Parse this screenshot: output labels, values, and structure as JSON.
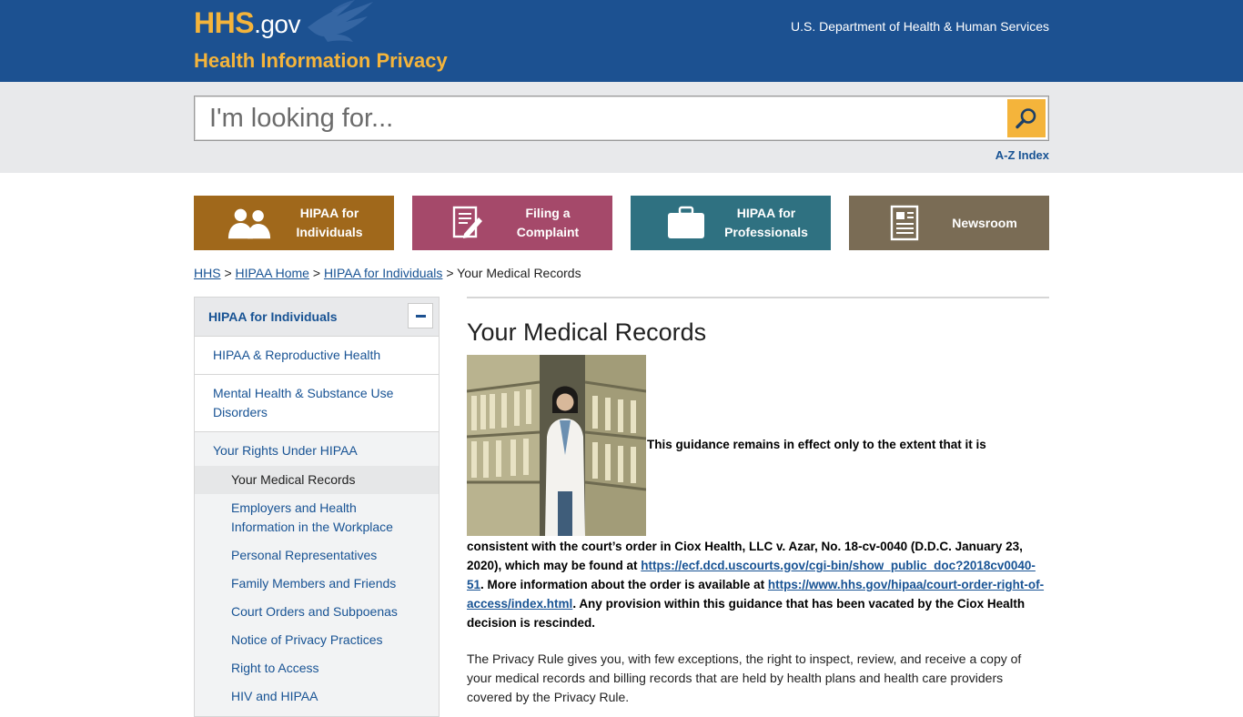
{
  "header": {
    "logo_main": "HHS",
    "logo_suffix": ".gov",
    "site_name": "Health Information Privacy",
    "department": "U.S. Department of Health & Human Services"
  },
  "search": {
    "placeholder": "I'm looking for...",
    "button_icon": "search-icon",
    "az_index": "A-Z Index"
  },
  "tiles": [
    {
      "label": "HIPAA for\nIndividuals",
      "icon": "people-icon",
      "color": "#a0681b"
    },
    {
      "label": "Filing a\nComplaint",
      "icon": "form-pencil-icon",
      "color": "#a5496a"
    },
    {
      "label": "HIPAA for\nProfessionals",
      "icon": "briefcase-icon",
      "color": "#2f7181"
    },
    {
      "label": "Newsroom",
      "icon": "newspaper-icon",
      "color": "#7a6c55"
    }
  ],
  "breadcrumb": {
    "items": [
      "HHS",
      "HIPAA Home",
      "HIPAA for Individuals"
    ],
    "separator": ">",
    "current": "Your Medical Records"
  },
  "sidebar": {
    "heading": "HIPAA for Individuals",
    "items": [
      "HIPAA & Reproductive Health",
      "Mental Health & Substance Use Disorders"
    ],
    "parent": "Your Rights Under HIPAA",
    "subitems": [
      "Your Medical Records",
      "Employers and Health Information in the Workplace",
      "Personal Representatives",
      "Family Members and Friends",
      "Court Orders and Subpoenas",
      "Notice of Privacy Practices",
      "Right to Access",
      "HIV and HIPAA"
    ]
  },
  "main": {
    "title": "Your Medical Records",
    "notice_line1": "This guidance remains in effect only to the extent that it is",
    "notice_line2": "consistent with the court’s order in Ciox Health, LLC v. Azar, No. 18-cv-0040 (D.D.C. January 23, 2020), which may be found at ",
    "notice_link1": "https://ecf.dcd.uscourts.gov/cgi-bin/show_public_doc?2018cv0040-51",
    "notice_mid": ". More information about the order is available at ",
    "notice_link2": "https://www.hhs.gov/hipaa/court-order-right-of-access/index.html",
    "notice_end": ". Any provision within this guidance that has been vacated by the Ciox Health decision is rescinded.",
    "paragraph": "The Privacy Rule gives you, with few exceptions, the right to inspect, review, and receive a copy of your medical records and billing records that are held by health plans and health care providers covered by the Privacy Rule."
  }
}
